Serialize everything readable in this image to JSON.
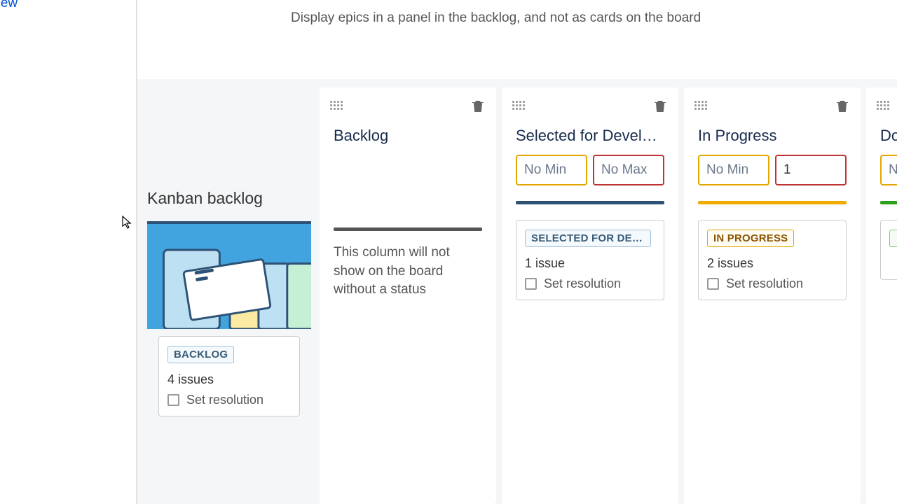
{
  "sidebar": {
    "link_fragment": "ail View"
  },
  "top": {
    "description": "Display epics in a panel in the backlog, and not as cards on the board"
  },
  "kanban_backlog": {
    "title": "Kanban backlog",
    "status": {
      "lozenge": "BACKLOG",
      "issues": "4 issues",
      "set_resolution": "Set resolution"
    }
  },
  "columns": {
    "backlog": {
      "title": "Backlog",
      "note": "This column will not show on the board without a status"
    },
    "selected": {
      "title": "Selected for Development",
      "min": "No Min",
      "max": "No Max",
      "status": {
        "lozenge": "SELECTED FOR DEVELOPMENT",
        "issues": "1 issue",
        "set_resolution": "Set resolution"
      }
    },
    "inprogress": {
      "title": "In Progress",
      "min": "No Min",
      "max": "1",
      "status": {
        "lozenge": "IN PROGRESS",
        "issues": "2 issues",
        "set_resolution": "Set resolution"
      }
    },
    "done": {
      "title": "Done",
      "min_fragment": "N"
    }
  }
}
